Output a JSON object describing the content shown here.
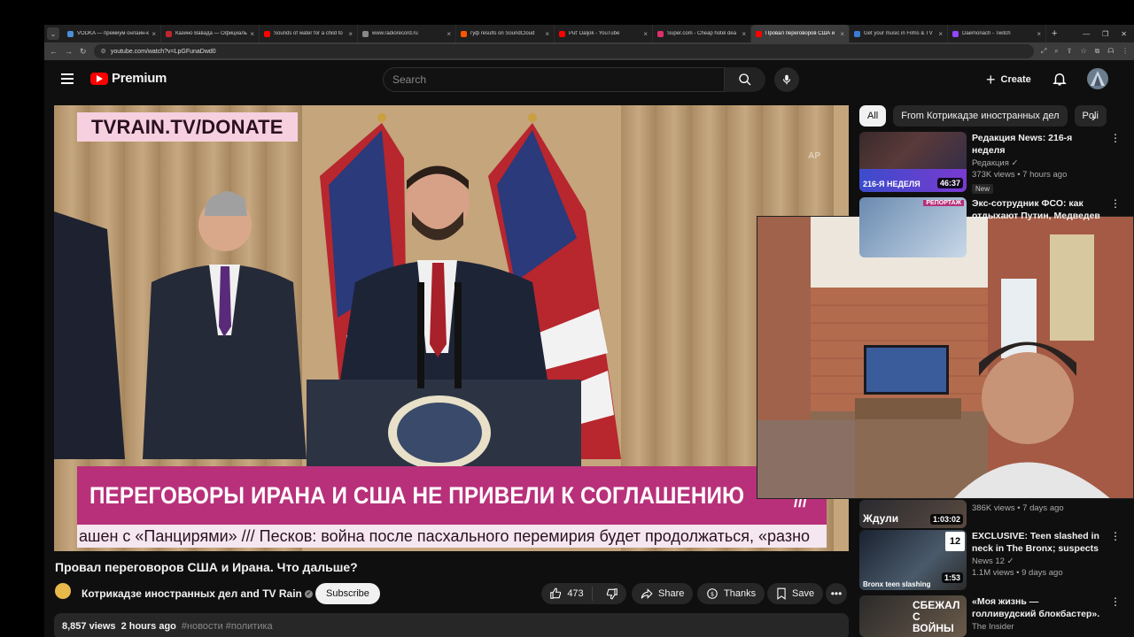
{
  "browser": {
    "tabs": [
      {
        "label": "VODKA — премиум онлайн-к",
        "color": "#4a90d9"
      },
      {
        "label": "Казино Вавада — Официаль",
        "color": "#c0262e"
      },
      {
        "label": "Sounds of water for a child to",
        "color": "#ff0000"
      },
      {
        "label": "www.radiorecord.ru",
        "color": "#888888"
      },
      {
        "label": "гуф results on SoundCloud",
        "color": "#ff5500"
      },
      {
        "label": "Put' Daljok - YouTube",
        "color": "#ff0000"
      },
      {
        "label": "Super.com - Cheap hotel dea",
        "color": "#e0306a"
      },
      {
        "label": "Провал переговоров США и",
        "color": "#ff0000"
      },
      {
        "label": "Get your music in Films & TV",
        "color": "#3a7bd5"
      },
      {
        "label": "Daemonach - Twitch",
        "color": "#9146ff"
      }
    ],
    "active_tab": 7,
    "url": "youtube.com/watch?v=LpGFunaDwd0"
  },
  "header": {
    "logo_text": "Premium",
    "search_placeholder": "Search",
    "create_label": "Create"
  },
  "video": {
    "overlay_donate": "TVRAIN.TV/DONATE",
    "overlay_ap": "AP",
    "headline": "ПЕРЕГОВОРЫ ИРАНА И США НЕ ПРИВЕЛИ К СОГЛАШЕНИЮ",
    "headline_mark": "///",
    "ticker": "ашен с «Панцирями» /// Песков: война после пасхального перемирия будет продолжаться, «разно",
    "title": "Провал переговоров США и Ирана. Что дальше?",
    "channel": "Котрикадзе иностранных дел and TV Rain",
    "subscribe_label": "Subscribe",
    "likes": "473",
    "share_label": "Share",
    "thanks_label": "Thanks",
    "save_label": "Save",
    "views": "8,857 views",
    "age": "2 hours ago",
    "tags": "#новости #политика"
  },
  "sidebar": {
    "chips": [
      "All",
      "From Котрикадзе иностранных дел",
      "Poli"
    ],
    "cards": [
      {
        "title": "Редакция News: 216-я неделя",
        "channel": "Редакция",
        "views": "373K views • 7 hours ago",
        "badge": "New",
        "duration": "46:37",
        "caption": "216-Я НЕДЕЛЯ"
      },
      {
        "title": "Экс-сотрудник ФСО: как отдыхают Путин, Медведев",
        "channel": "",
        "views": "",
        "badge": "",
        "duration": "",
        "caption": "РЕПОРТАЖ"
      },
      {
        "title": "",
        "channel": "",
        "views": "386K views • 7 days ago",
        "badge": "",
        "duration": "1:03:02",
        "caption": "Ждули"
      },
      {
        "title": "EXCLUSIVE: Teen slashed in neck in The Bronx; suspects st...",
        "channel": "News 12",
        "views": "1.1M views • 9 days ago",
        "badge": "",
        "duration": "1:53",
        "caption": "Bronx teen slashing"
      },
      {
        "title": "«Моя жизнь — голливудский блокбастер». История казак...",
        "channel": "The Insider",
        "views": "",
        "badge": "",
        "duration": "",
        "caption": "СБЕЖАЛ С ВОЙНЫ"
      }
    ]
  }
}
